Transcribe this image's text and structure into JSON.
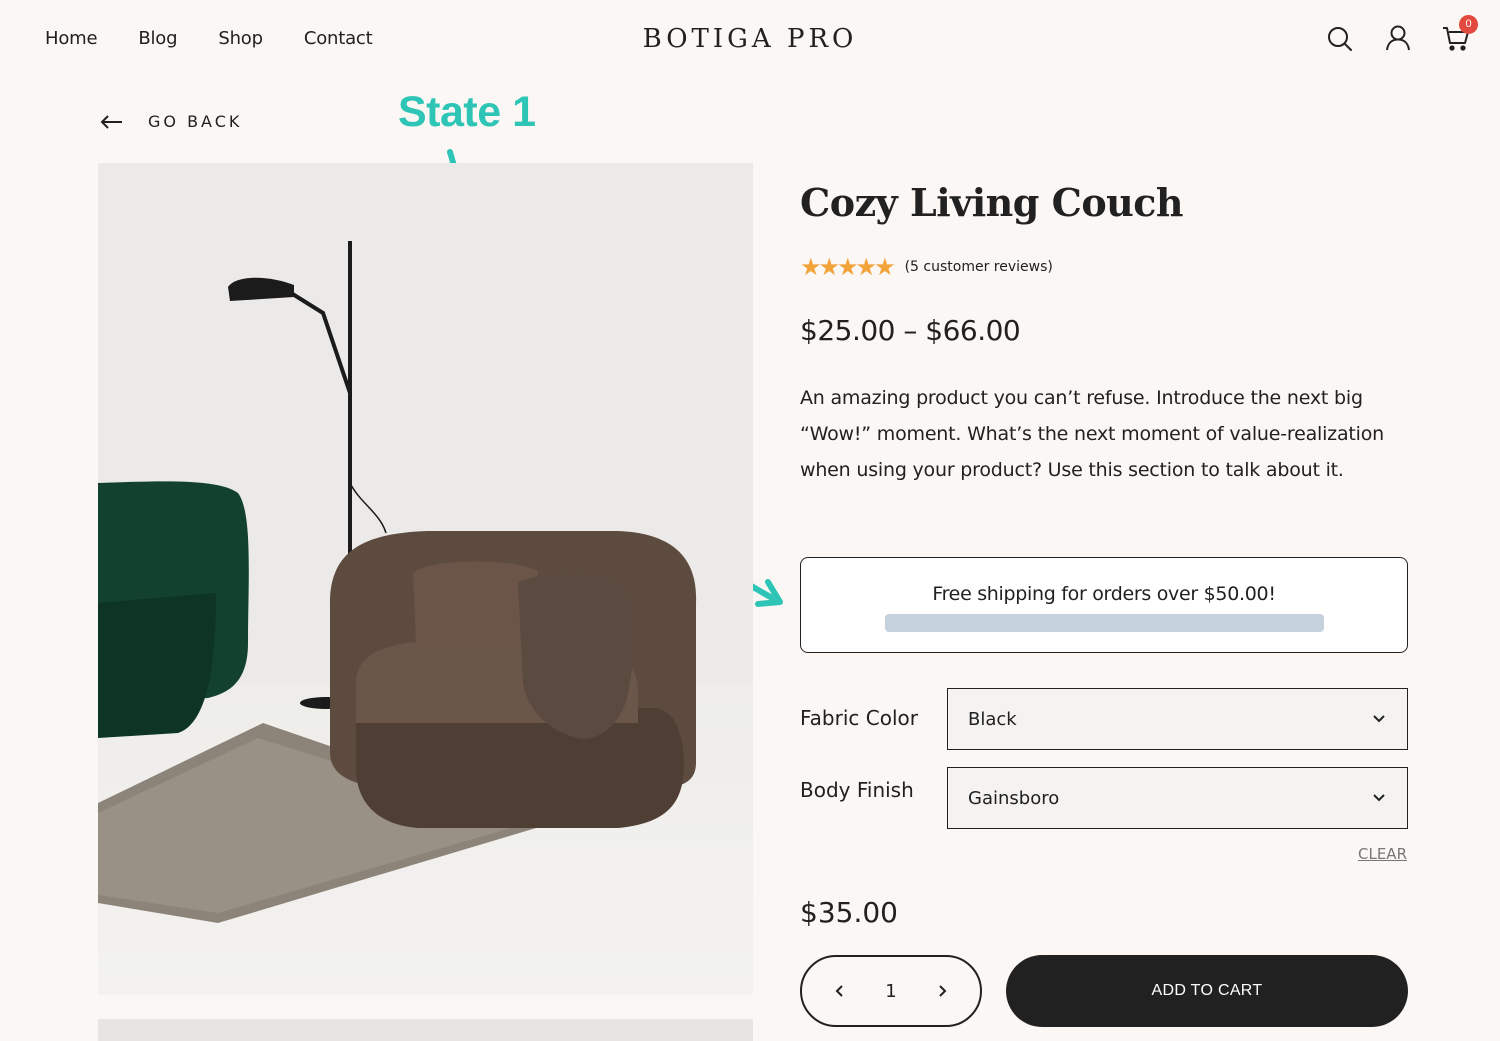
{
  "header": {
    "nav": [
      "Home",
      "Blog",
      "Shop",
      "Contact"
    ],
    "logo": "BOTIGA PRO",
    "cart_count": "0",
    "icons": [
      "search-icon",
      "user-icon",
      "cart-icon"
    ]
  },
  "go_back": "GO BACK",
  "annotation": {
    "label": "State 1",
    "color": "#2ec4b6"
  },
  "product": {
    "title": "Cozy Living Couch",
    "stars": "★★★★★",
    "rating_out_of_5": 5,
    "reviews": "(5 customer reviews)",
    "price_range": "$25.00 – $66.00",
    "description": "An amazing product you can’t refuse. Introduce the next big “Wow!” moment. What’s the next moment of value-realization when using your product? Use this section to talk about it.",
    "shipping_notice": "Free shipping for orders over $50.00!",
    "shipping_progress_percent": 0,
    "variations": [
      {
        "label": "Fabric Color",
        "selected": "Black"
      },
      {
        "label": "Body Finish",
        "selected": "Gainsboro"
      }
    ],
    "clear": "CLEAR",
    "variation_price": "$35.00",
    "quantity": "1",
    "add_to_cart": "ADD TO CART"
  },
  "colors": {
    "background": "#fbf7f4",
    "text": "#212121",
    "star": "#f2a33a",
    "badge": "#e24a40",
    "progress_track": "#c6d1de",
    "annotation": "#2ec4b6"
  }
}
